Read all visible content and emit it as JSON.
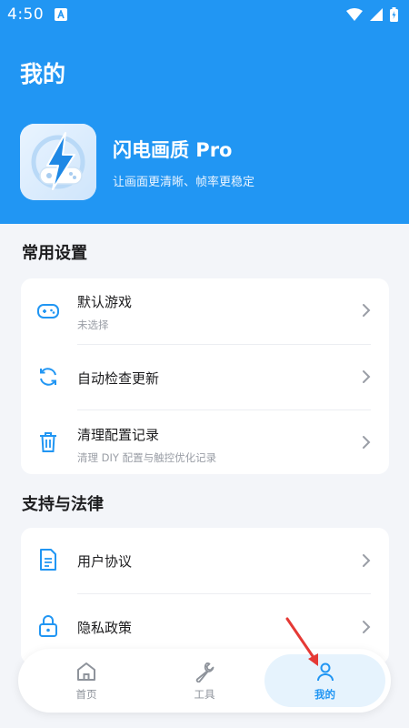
{
  "status_bar": {
    "time": "4:50"
  },
  "header": {
    "title": "我的"
  },
  "app": {
    "name": "闪电画质 Pro",
    "slogan": "让画面更清晰、帧率更稳定"
  },
  "sections": {
    "common": {
      "title": "常用设置",
      "items": [
        {
          "title": "默认游戏",
          "subtitle": "未选择",
          "icon": "gamepad-icon"
        },
        {
          "title": "自动检查更新",
          "subtitle": "",
          "icon": "refresh-icon"
        },
        {
          "title": "清理配置记录",
          "subtitle": "清理 DIY 配置与触控优化记录",
          "icon": "trash-icon"
        }
      ]
    },
    "legal": {
      "title": "支持与法律",
      "items": [
        {
          "title": "用户协议",
          "icon": "document-icon"
        },
        {
          "title": "隐私政策",
          "icon": "lock-icon"
        }
      ]
    }
  },
  "nav": {
    "items": [
      {
        "label": "首页",
        "icon": "home-icon"
      },
      {
        "label": "工具",
        "icon": "wrench-icon"
      },
      {
        "label": "我的",
        "icon": "user-icon",
        "active": true
      }
    ]
  },
  "colors": {
    "primary": "#2196f3",
    "background": "#f3f5f9",
    "annotation": "#e53935"
  }
}
